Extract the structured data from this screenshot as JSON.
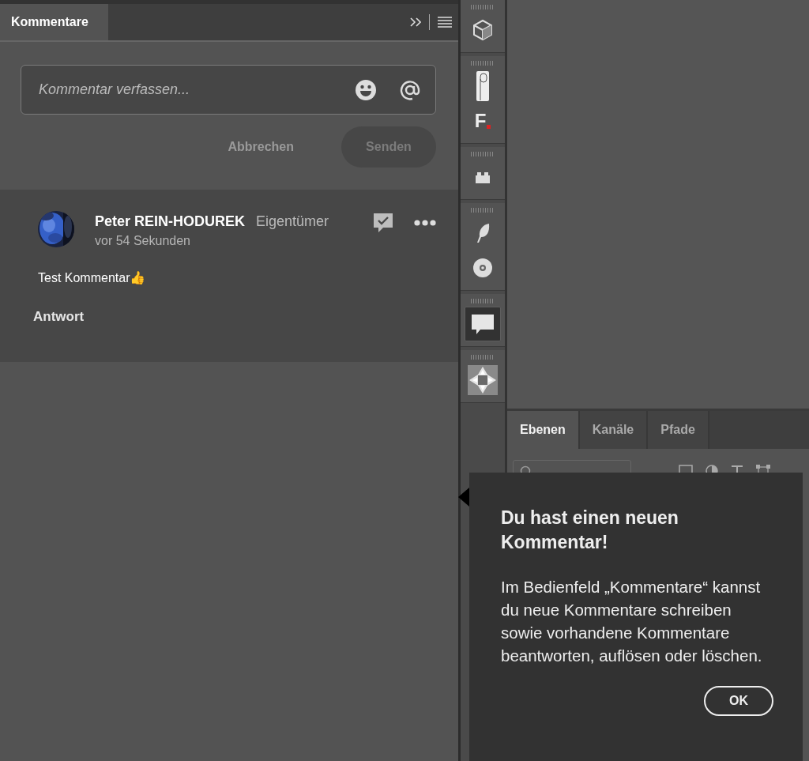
{
  "comments_panel": {
    "tabs": [
      {
        "label": "Kommentare",
        "selected": true
      }
    ],
    "composer": {
      "placeholder": "Kommentar verfassen..."
    },
    "buttons": [
      {
        "label": "Abbrechen",
        "kind": "text"
      },
      {
        "label": "Senden",
        "kind": "pill"
      }
    ],
    "comments": [
      {
        "author": "Peter REIN-HODUREK",
        "role": "Eigentümer",
        "time": "vor 54 Sekunden",
        "text": "Test Kommentar👍",
        "reply_label": "Antwort"
      }
    ]
  },
  "tool_strip": {
    "groups": [
      {
        "tools": [
          {
            "kind": "cube",
            "selected": false
          }
        ]
      },
      {
        "tools": [
          {
            "kind": "document",
            "selected": false
          },
          {
            "kind": "letter",
            "glyph": "F",
            "selected": false
          }
        ]
      },
      {
        "tools": [
          {
            "kind": "brick",
            "selected": false
          }
        ]
      },
      {
        "tools": [
          {
            "kind": "feather",
            "selected": false
          },
          {
            "kind": "disc",
            "selected": false
          }
        ]
      },
      {
        "tools": [
          {
            "kind": "comment",
            "selected": true
          }
        ]
      },
      {
        "tools": [
          {
            "kind": "star",
            "selected": false
          }
        ]
      }
    ]
  },
  "layers_panel": {
    "tabs": [
      {
        "label": "Ebenen",
        "selected": true
      },
      {
        "label": "Kanäle",
        "selected": false
      },
      {
        "label": "Pfade",
        "selected": false
      }
    ]
  },
  "popover": {
    "title": "Du hast einen neuen Kommentar!",
    "body": "Im Bedienfeld „Kommentare“ kannst du neue Kommentare schreiben sowie vorhandene Kommentare beantworten, auflösen oder löschen.",
    "button": "OK"
  }
}
